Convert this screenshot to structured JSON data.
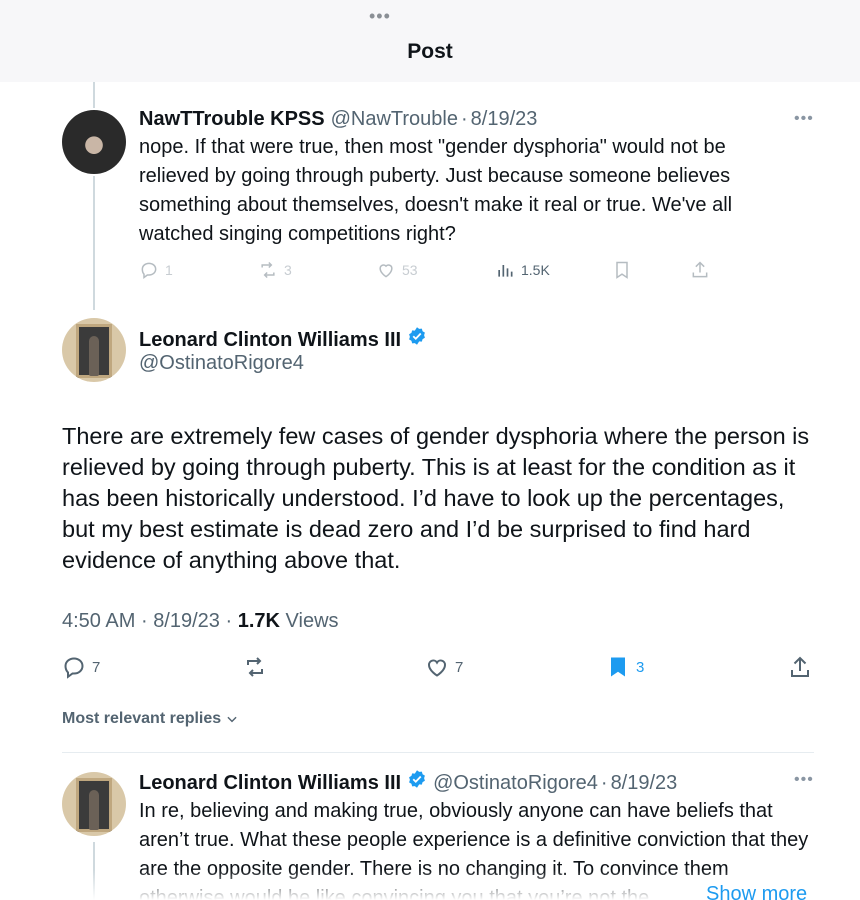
{
  "header": {
    "more_dots": "•••",
    "title": "Post"
  },
  "reply1": {
    "name": "NawTTrouble KPSS",
    "handle": "@NawTrouble",
    "sep": "·",
    "date": "8/19/23",
    "more": "•••",
    "text": "nope. If that were true, then most \"gender dysphoria\" would not be relieved by going through puberty. Just because someone believes something about themselves, doesn't make it real or true. We've all watched singing competitions right?",
    "actions": {
      "replies": "1",
      "reposts": "3",
      "likes": "53",
      "views": "1.5K"
    }
  },
  "main": {
    "name": "Leonard Clinton Williams III",
    "handle": "@OstinatoRigore4",
    "text": "There are extremely few cases of gender dysphoria where the person is relieved by going through puberty. This is at least for the condition as it has been historically understood. I’d have to look up the percentages, but my best estimate is dead zero and I’d be surprised to find hard evidence of anything above that.",
    "time": "4:50 AM",
    "sep": "·",
    "date": "8/19/23",
    "views_count": "1.7K",
    "views_label": "Views",
    "actions": {
      "replies": "7",
      "likes": "7",
      "bookmarks": "3"
    }
  },
  "replies_sort": {
    "label": "Most relevant replies"
  },
  "reply2": {
    "name": "Leonard Clinton Williams III",
    "handle": "@OstinatoRigore4",
    "sep": "·",
    "date": "8/19/23",
    "more": "•••",
    "text": "In re, believing and making true, obviously anyone can have beliefs that aren’t true. What these people experience is a definitive conviction that they are the opposite gender. There is no changing it. To convince them otherwise would be like convincing you that you’re not the",
    "show_more": "Show more"
  },
  "colors": {
    "accent": "#1d9bf0",
    "text": "#0f1419",
    "secondary": "#536471"
  }
}
